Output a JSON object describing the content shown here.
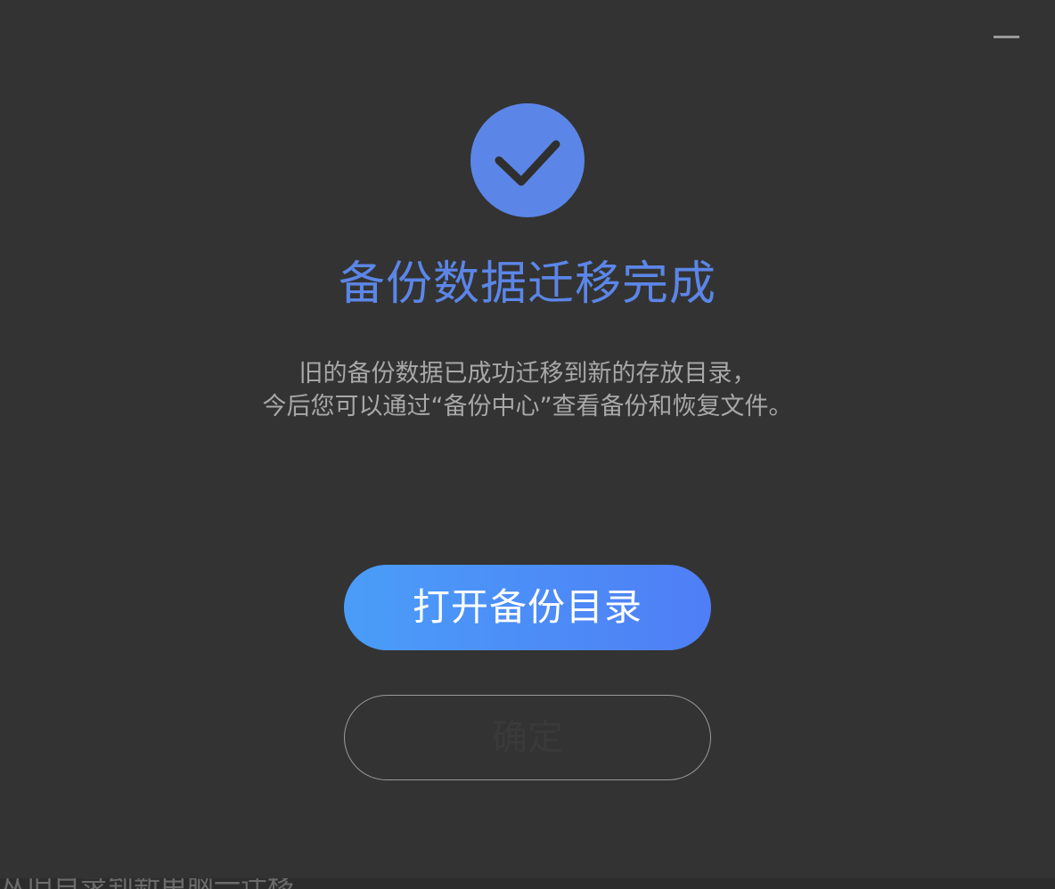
{
  "window": {
    "minimize_label": "Minimize"
  },
  "status": {
    "icon": "checkmark-icon",
    "title": "备份数据迁移完成",
    "description_line1": "旧的备份数据已成功迁移到新的存放目录，",
    "description_line2": "今后您可以通过“备份中心”查看备份和恢复文件。"
  },
  "actions": {
    "primary_label": "打开备份目录",
    "secondary_label": "确定"
  },
  "background_text": "从旧目录到新电脑一迁移",
  "colors": {
    "background": "#333333",
    "accent": "#5b86e8",
    "button_gradient_start": "#4a9df8",
    "button_gradient_end": "#4f7ef6",
    "text_secondary": "#a8a8a8"
  }
}
